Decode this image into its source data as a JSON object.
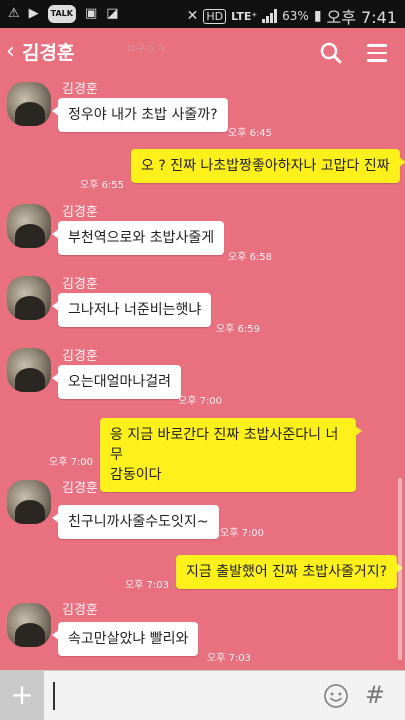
{
  "statusbar": {
    "hd": "HD",
    "lte": "LTE⁺",
    "battery": "63%",
    "time": "오후 7:41",
    "talk_badge": "TALK"
  },
  "header": {
    "title": "김경훈",
    "watermark": "ㅁ구ㅇㅋ",
    "accent": "#e9707f"
  },
  "messages": [
    {
      "from": "them",
      "name": "김경훈",
      "text": "정우야 내가 초밥 사줄까?",
      "time": "오후 6:45"
    },
    {
      "from": "me",
      "text": "오 ? 진짜 나초밥짱좋아하자나 고맙다 진짜",
      "time": "오후 6:55"
    },
    {
      "from": "them",
      "name": "김경훈",
      "text": "부천역으로와 초밥사줄게",
      "time": "오후 6:58"
    },
    {
      "from": "them",
      "name": "김경훈",
      "text": "그나저나 너준비는햇냐",
      "time": "오후 6:59"
    },
    {
      "from": "them",
      "name": "김경훈",
      "text": "오는대얼마나걸려",
      "time": "오후 7:00"
    },
    {
      "from": "me",
      "text_line1": "응 지금 바로간다 진짜 초밥사준다니 너무",
      "text_line2": "감동이다",
      "time": "오후 7:00"
    },
    {
      "from": "them",
      "name": "김경훈",
      "text": "친구니까사줄수도잇지~",
      "time": "오후 7:00"
    },
    {
      "from": "me",
      "text": "지금 출발했어 진짜 초밥사줄거지?",
      "time": "오후 7:03"
    },
    {
      "from": "them",
      "name": "김경훈",
      "text": "속고만살았냐 빨리와",
      "time": "오후 7:03"
    }
  ],
  "inputbar": {
    "plus": "+",
    "hash": "#",
    "input_value": ""
  },
  "colors": {
    "background": "#e9707f",
    "my_bubble": "#fef01b",
    "their_bubble": "#ffffff"
  }
}
